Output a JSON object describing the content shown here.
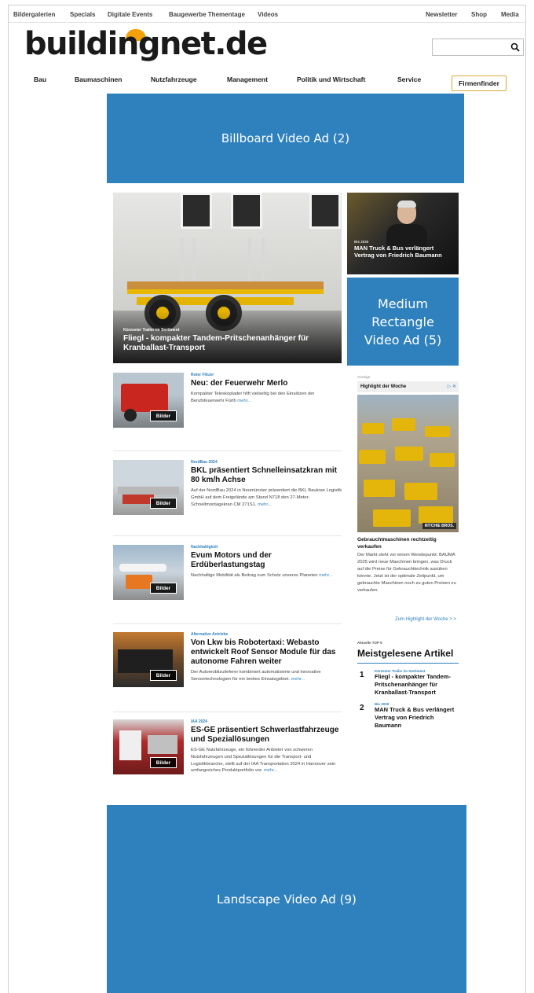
{
  "topbar": {
    "left_links": [
      "Bildergalerien",
      "Specials",
      "Digitale Events",
      "Baugewerbe Thementage",
      "Videos"
    ],
    "right_links": [
      "Newsletter",
      "Shop",
      "Media"
    ]
  },
  "logo": {
    "text": "buildingnet.de"
  },
  "search": {
    "value": "",
    "icon": "search-icon"
  },
  "nav": {
    "items": [
      "Bau",
      "Baumaschinen",
      "Nutzfahrzeuge",
      "Management",
      "Politik und Wirtschaft",
      "Service"
    ],
    "firmenfinder": "Firmenfinder"
  },
  "ads": {
    "billboard": "Billboard Video Ad (2)",
    "medium_rectangle": "Medium Rectangle Video Ad (5)",
    "landscape": "Landscape Video Ad (9)"
  },
  "hero": {
    "kicker": "Kürzester Trailer im Sortiment",
    "title": "Fliegl - kompakter Tandem-Pritschenanhänger für Kranballast-Transport"
  },
  "side_teaser": {
    "kicker": "Bis 2030",
    "title": "MAN Truck & Bus verlängert Vertrag von Friedrich Baumann"
  },
  "articles": [
    {
      "kicker": "Roter Flitzer",
      "title": "Neu: der Feuerwehr Merlo",
      "teaser": "Kompakter Teleskoplader hilft vielseitig bei den Einsätzen der Berufsfeuerwehr Fürth",
      "more": "mehr...",
      "bilder": "Bilder"
    },
    {
      "kicker": "NordBau 2024",
      "title": "BKL präsentiert Schnelleinsatzkran mit 80 km/h Achse",
      "teaser": "Auf der NordBau 2024 in Neumünster präsentiert die BKL Baukran Logistik GmbH auf dem Freigelände am Stand N718 den 27-Meter-Schnellmontagekran CM 271S1.",
      "more": "mehr...",
      "bilder": "Bilder"
    },
    {
      "kicker": "Nachhaltigkeit",
      "title": "Evum Motors und der Erdüberlastungstag",
      "teaser": "Nachhaltige Mobilität als Beitrag zum Schutz unseres Planeten",
      "more": "mehr...",
      "bilder": "Bilder"
    },
    {
      "kicker": "Alternative Antriebe",
      "title": "Von Lkw bis Robotertaxi: Webasto entwickelt Roof Sensor Module für das autonome Fahren weiter",
      "teaser": "Der Automobilzulieferer kombiniert automatisierte und innovative Sensortechnologien für ein breites Einsatzgebiet.",
      "more": "mehr...",
      "bilder": "Bilder"
    },
    {
      "kicker": "IAA 2024",
      "title": "ES-GE präsentiert Schwerlastfahrzeuge und Speziallösungen",
      "teaser": "ES-GE Nutzfahrzeuge, ein führender Anbieter von schweren Nutzfahrzeugen und Speziallösungen für die Transport- und Logistikbranche, stellt auf der IAA Transportation 2024 in Hannover sein umfangreiches Produktportfolio vor.",
      "more": "mehr...",
      "bilder": "Bilder"
    }
  ],
  "highlight": {
    "anzeige": "Anzeige",
    "title": "Highlight der Woche",
    "ad_marker": "▷ ✕",
    "brand": "RITCHIE BROS.",
    "headline": "Gebrauchtmaschinen rechtzeitig verkaufen",
    "body": "Der Markt steht vor einem Wendepunkt: BAUMA 2025 wird neue Maschinen bringen, was Druck auf die Preise für Gebrauchttechnik ausüben könnte. Jetzt ist der optimale Zeitpunkt, um gebrauchte Maschinen noch zu guten Preisen zu verkaufen.",
    "link": "Zum Highlight der Woche > >"
  },
  "top5": {
    "kicker": "Aktuelle TOP 5",
    "heading": "Meistgelesene Artikel",
    "items": [
      {
        "num": "1",
        "kicker": "Kürzester Trailer im Sortiment",
        "title": "Fliegl - kompakter Tandem-Pritschenanhänger für Kranballast-Transport"
      },
      {
        "num": "2",
        "kicker": "Bis 2030",
        "title": "MAN Truck & Bus verlängert Vertrag von Friedrich Baumann"
      }
    ]
  },
  "colors": {
    "accent_blue": "#2f81bd",
    "logo_orange": "#f2a10b",
    "firmenfinder_border": "#d8a93a"
  }
}
